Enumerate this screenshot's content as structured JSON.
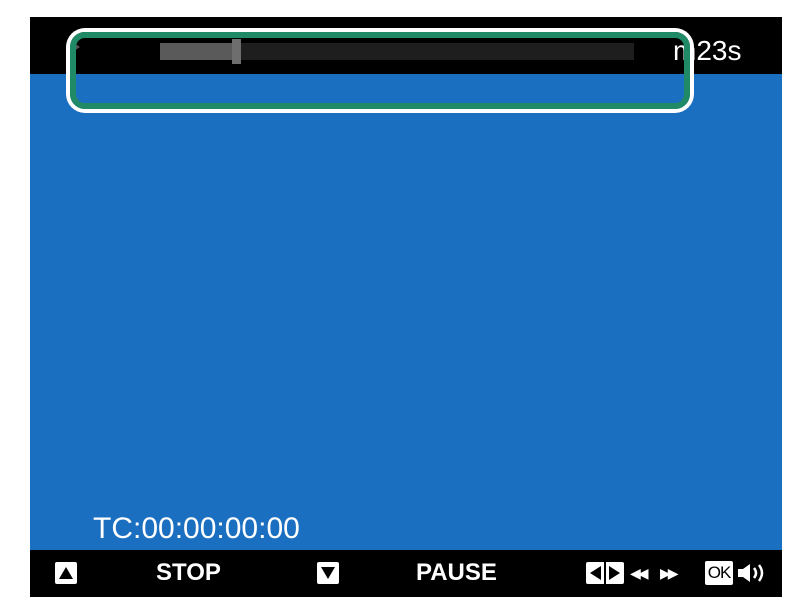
{
  "colors": {
    "screen_background": "#1a6fc1",
    "bar_background": "#000000",
    "highlight_frame": "#1f8a65",
    "progress_track": "#1e1e1e",
    "progress_fill": "#5a5a5a",
    "text": "#ffffff"
  },
  "top_bar": {
    "play_icon": "play-icon",
    "progress": 0.16,
    "time_remaining": "m23s",
    "highlighted": true
  },
  "timecode": "TC:00:00:00:00",
  "bottom_bar": {
    "up_icon": "up-arrow-key-icon",
    "stop_label": "STOP",
    "down_icon": "down-arrow-key-icon",
    "pause_label": "PAUSE",
    "left_right_icon": "left-right-key-icon",
    "rewind_glyph": "◀◀",
    "fast_forward_glyph": "▶▶",
    "ok_label": "OK",
    "volume_icon": "volume-icon"
  }
}
